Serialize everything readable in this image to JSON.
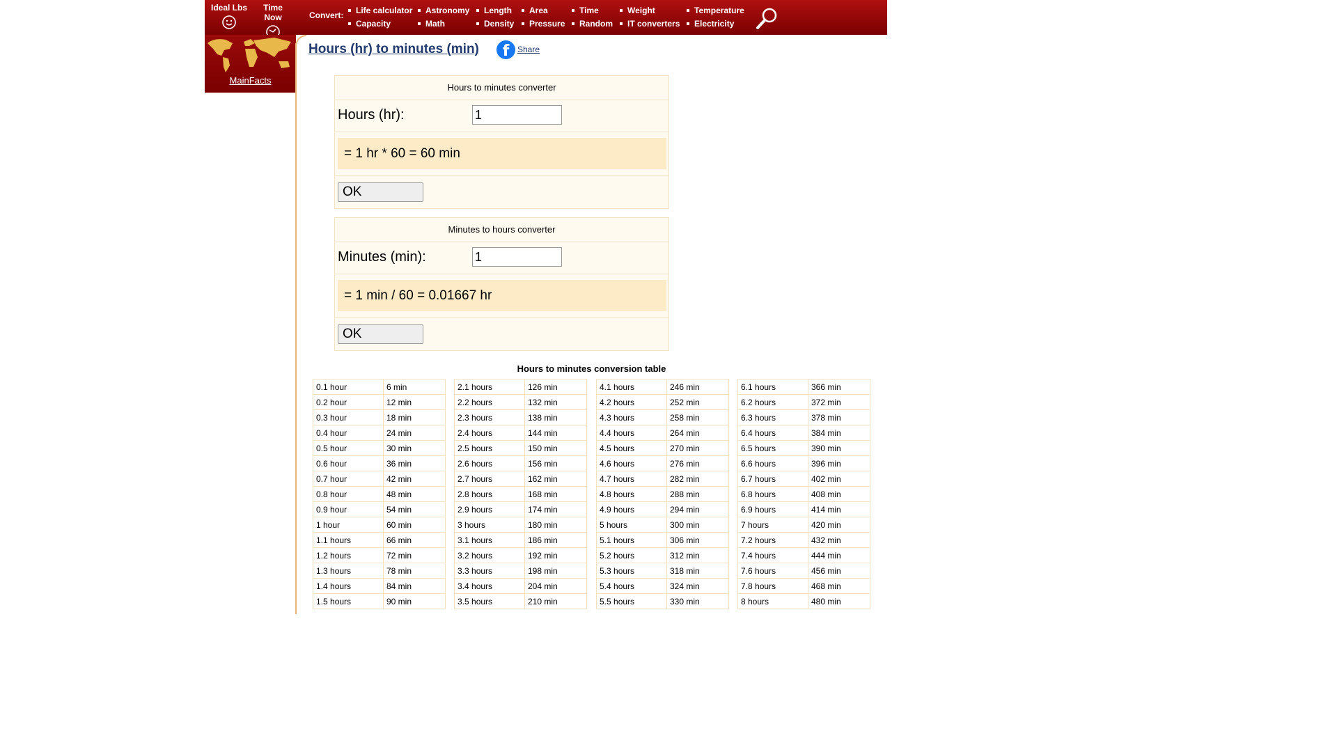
{
  "header": {
    "shortcuts": [
      {
        "label": "Ideal Lbs",
        "icon": "smiley-icon"
      },
      {
        "label": "Time Now",
        "icon": "clock-icon"
      }
    ],
    "convert_label": "Convert",
    "menu": [
      [
        "Life calculator",
        "Astronomy",
        "Length",
        "Area",
        "Time",
        "Weight",
        "Temperature"
      ],
      [
        "Capacity",
        "Math",
        "Density",
        "Pressure",
        "Random",
        "IT converters",
        "Electricity"
      ]
    ]
  },
  "sidebar": {
    "link": "MainFacts"
  },
  "page": {
    "title": "Hours (hr) to minutes (min)",
    "share_label": "Share"
  },
  "converter1": {
    "heading": "Hours to minutes converter",
    "label": "Hours (hr):",
    "value": "1",
    "result": "= 1 hr * 60 = 60 min",
    "button": "OK"
  },
  "converter2": {
    "heading": "Minutes to hours converter",
    "label": "Minutes (min):",
    "value": "1",
    "result": "= 1 min / 60 = 0.01667 hr",
    "button": "OK"
  },
  "table": {
    "title": "Hours to minutes conversion table",
    "columns": [
      [
        [
          "0.1 hour",
          "6 min"
        ],
        [
          "0.2 hour",
          "12 min"
        ],
        [
          "0.3 hour",
          "18 min"
        ],
        [
          "0.4 hour",
          "24 min"
        ],
        [
          "0.5 hour",
          "30 min"
        ],
        [
          "0.6 hour",
          "36 min"
        ],
        [
          "0.7 hour",
          "42 min"
        ],
        [
          "0.8 hour",
          "48 min"
        ],
        [
          "0.9 hour",
          "54 min"
        ],
        [
          "1 hour",
          "60 min"
        ],
        [
          "1.1 hours",
          "66 min"
        ],
        [
          "1.2 hours",
          "72 min"
        ],
        [
          "1.3 hours",
          "78 min"
        ],
        [
          "1.4 hours",
          "84 min"
        ],
        [
          "1.5 hours",
          "90 min"
        ]
      ],
      [
        [
          "2.1 hours",
          "126 min"
        ],
        [
          "2.2 hours",
          "132 min"
        ],
        [
          "2.3 hours",
          "138 min"
        ],
        [
          "2.4 hours",
          "144 min"
        ],
        [
          "2.5 hours",
          "150 min"
        ],
        [
          "2.6 hours",
          "156 min"
        ],
        [
          "2.7 hours",
          "162 min"
        ],
        [
          "2.8 hours",
          "168 min"
        ],
        [
          "2.9 hours",
          "174 min"
        ],
        [
          "3 hours",
          "180 min"
        ],
        [
          "3.1 hours",
          "186 min"
        ],
        [
          "3.2 hours",
          "192 min"
        ],
        [
          "3.3 hours",
          "198 min"
        ],
        [
          "3.4 hours",
          "204 min"
        ],
        [
          "3.5 hours",
          "210 min"
        ]
      ],
      [
        [
          "4.1 hours",
          "246 min"
        ],
        [
          "4.2 hours",
          "252 min"
        ],
        [
          "4.3 hours",
          "258 min"
        ],
        [
          "4.4 hours",
          "264 min"
        ],
        [
          "4.5 hours",
          "270 min"
        ],
        [
          "4.6 hours",
          "276 min"
        ],
        [
          "4.7 hours",
          "282 min"
        ],
        [
          "4.8 hours",
          "288 min"
        ],
        [
          "4.9 hours",
          "294 min"
        ],
        [
          "5 hours",
          "300 min"
        ],
        [
          "5.1 hours",
          "306 min"
        ],
        [
          "5.2 hours",
          "312 min"
        ],
        [
          "5.3 hours",
          "318 min"
        ],
        [
          "5.4 hours",
          "324 min"
        ],
        [
          "5.5 hours",
          "330 min"
        ]
      ],
      [
        [
          "6.1 hours",
          "366 min"
        ],
        [
          "6.2 hours",
          "372 min"
        ],
        [
          "6.3 hours",
          "378 min"
        ],
        [
          "6.4 hours",
          "384 min"
        ],
        [
          "6.5 hours",
          "390 min"
        ],
        [
          "6.6 hours",
          "396 min"
        ],
        [
          "6.7 hours",
          "402 min"
        ],
        [
          "6.8 hours",
          "408 min"
        ],
        [
          "6.9 hours",
          "414 min"
        ],
        [
          "7 hours",
          "420 min"
        ],
        [
          "7.2 hours",
          "432 min"
        ],
        [
          "7.4 hours",
          "444 min"
        ],
        [
          "7.6 hours",
          "456 min"
        ],
        [
          "7.8 hours",
          "468 min"
        ],
        [
          "8 hours",
          "480 min"
        ]
      ]
    ]
  }
}
